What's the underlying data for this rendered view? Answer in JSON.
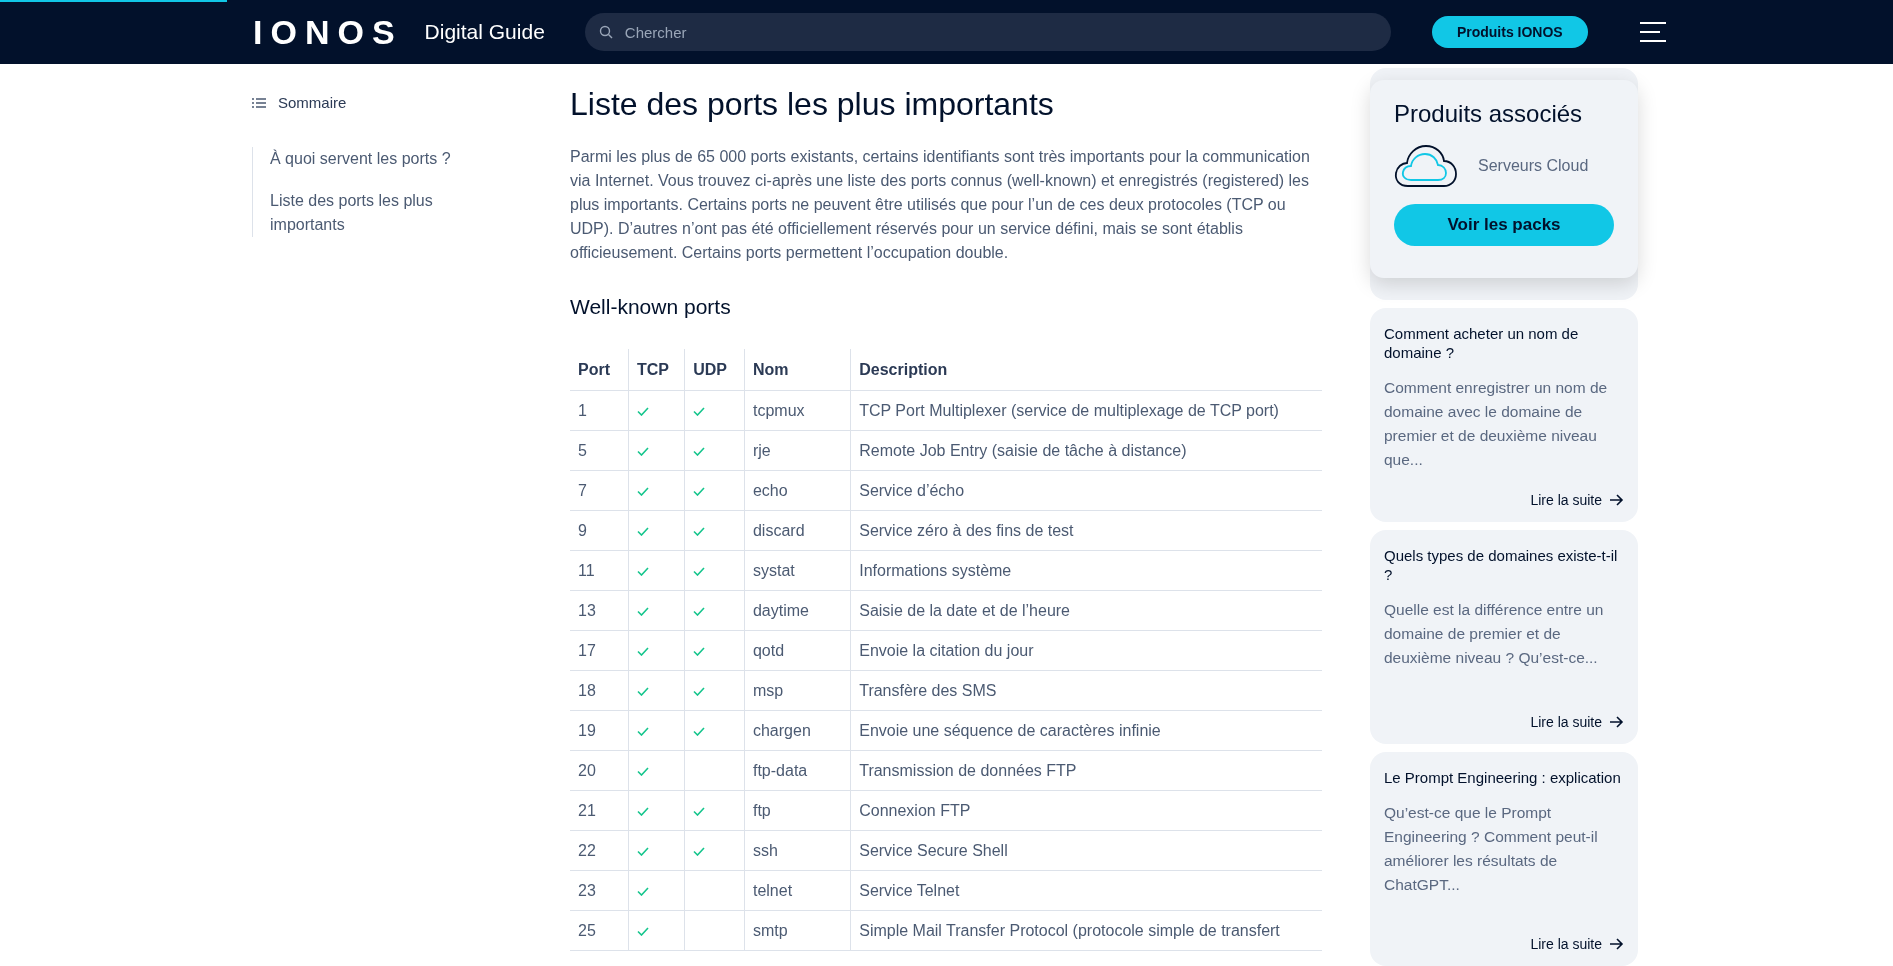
{
  "reading_progress": {
    "level": 0.12
  },
  "header": {
    "logo": "IONOS",
    "site_name": "Digital Guide",
    "search": {
      "placeholder": "Chercher"
    },
    "cta": "Produits IONOS"
  },
  "toc": {
    "title": "Sommaire",
    "items": [
      {
        "label": "À quoi servent les ports ?",
        "selected": false
      },
      {
        "label": "Liste des ports les plus importants",
        "selected": false
      }
    ]
  },
  "article": {
    "title": "Liste des ports les plus importants",
    "paragraph": "Parmi les plus de 65 000 ports existants, certains identifiants sont très importants pour la communication via Internet. Vous trouvez ci-après une liste des ports connus (well-known) et enregistrés (registered) les plus importants. Certains ports ne peuvent être utilisés que pour l’un de ces deux protocoles (TCP ou UDP). D’autres n’ont pas été officiellement réservés pour un service défini, mais se sont établis officieusement. Certains ports permettent l’occupation double.",
    "subtitle": "Well-known ports",
    "table": {
      "columns": [
        "Port",
        "TCP",
        "UDP",
        "Nom",
        "Description"
      ],
      "rows": [
        {
          "port": "1",
          "tcp": true,
          "udp": true,
          "name": "tcpmux",
          "description": "TCP Port Multiplexer (service de multiplexage de TCP port)"
        },
        {
          "port": "5",
          "tcp": true,
          "udp": true,
          "name": "rje",
          "description": "Remote Job Entry (saisie de tâche à distance)"
        },
        {
          "port": "7",
          "tcp": true,
          "udp": true,
          "name": "echo",
          "description": "Service d’écho"
        },
        {
          "port": "9",
          "tcp": true,
          "udp": true,
          "name": "discard",
          "description": "Service zéro à des fins de test"
        },
        {
          "port": "11",
          "tcp": true,
          "udp": true,
          "name": "systat",
          "description": "Informations système"
        },
        {
          "port": "13",
          "tcp": true,
          "udp": true,
          "name": "daytime",
          "description": "Saisie de la date et de l’heure"
        },
        {
          "port": "17",
          "tcp": true,
          "udp": true,
          "name": "qotd",
          "description": "Envoie la citation du jour"
        },
        {
          "port": "18",
          "tcp": true,
          "udp": true,
          "name": "msp",
          "description": "Transfère des SMS"
        },
        {
          "port": "19",
          "tcp": true,
          "udp": true,
          "name": "chargen",
          "description": "Envoie une séquence de caractères infinie"
        },
        {
          "port": "20",
          "tcp": true,
          "udp": false,
          "name": "ftp-data",
          "description": "Transmission de données FTP"
        },
        {
          "port": "21",
          "tcp": true,
          "udp": true,
          "name": "ftp",
          "description": "Connexion FTP"
        },
        {
          "port": "22",
          "tcp": true,
          "udp": true,
          "name": "ssh",
          "description": "Service Secure Shell"
        },
        {
          "port": "23",
          "tcp": true,
          "udp": false,
          "name": "telnet",
          "description": "Service Telnet"
        },
        {
          "port": "25",
          "tcp": true,
          "udp": false,
          "name": "smtp",
          "description": "Simple Mail Transfer Protocol (protocole simple de transfert"
        }
      ]
    }
  },
  "related_products": {
    "title": "Produits associés",
    "product": "Serveurs Cloud",
    "button": "Voir les packs"
  },
  "related_articles": [
    {
      "title": "Comment acheter un nom de domaine ?",
      "excerpt": "Comment enregistrer un nom de domaine avec le domaine de premier et de deuxième niveau que...",
      "link": "Lire la suite"
    },
    {
      "title": "Quels types de domaines existe-t-il ?",
      "excerpt": "Quelle est la différence entre un domaine de premier et de deuxième niveau ? Qu’est-ce...",
      "link": "Lire la suite"
    },
    {
      "title": "Le Prompt Engineering : explication",
      "excerpt": "Qu’est-ce que le Prompt Engineering ? Comment peut-il améliorer les résultats de ChatGPT...",
      "link": "Lire la suite"
    }
  ]
}
